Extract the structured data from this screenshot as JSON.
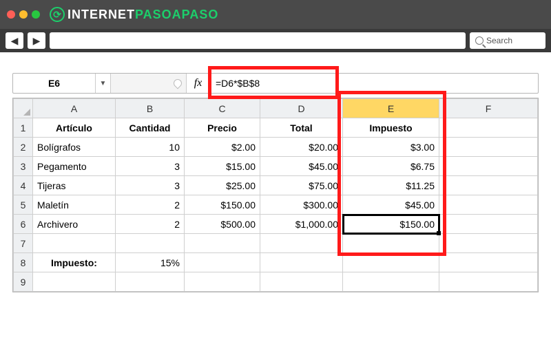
{
  "brand": {
    "white": "INTERNET",
    "green": "PASOAPASO"
  },
  "search": {
    "placeholder": "Search"
  },
  "nav": {
    "back": "◀",
    "fwd": "▶"
  },
  "formula_bar": {
    "name_box": "E6",
    "fx": "fx",
    "formula": "=D6*$B$8"
  },
  "columns": [
    "A",
    "B",
    "C",
    "D",
    "E",
    "F"
  ],
  "rows": [
    "1",
    "2",
    "3",
    "4",
    "5",
    "6",
    "7",
    "8",
    "9"
  ],
  "headers": {
    "A": "Artículo",
    "B": "Cantidad",
    "C": "Precio",
    "D": "Total",
    "E": "Impuesto"
  },
  "data": [
    {
      "art": "Bolígrafos",
      "cant": "10",
      "precio": "$2.00",
      "total": "$20.00",
      "imp": "$3.00"
    },
    {
      "art": "Pegamento",
      "cant": "3",
      "precio": "$15.00",
      "total": "$45.00",
      "imp": "$6.75"
    },
    {
      "art": "Tijeras",
      "cant": "3",
      "precio": "$25.00",
      "total": "$75.00",
      "imp": "$11.25"
    },
    {
      "art": "Maletín",
      "cant": "2",
      "precio": "$150.00",
      "total": "$300.00",
      "imp": "$45.00"
    },
    {
      "art": "Archivero",
      "cant": "2",
      "precio": "$500.00",
      "total": "$1,000.00",
      "imp": "$150.00"
    }
  ],
  "tax_row": {
    "label": "Impuesto:",
    "value": "15%"
  },
  "chart_data": {
    "type": "table",
    "title": "Spreadsheet with tax calculation",
    "columns": [
      "Artículo",
      "Cantidad",
      "Precio",
      "Total",
      "Impuesto"
    ],
    "rows": [
      [
        "Bolígrafos",
        10,
        2.0,
        20.0,
        3.0
      ],
      [
        "Pegamento",
        3,
        15.0,
        45.0,
        6.75
      ],
      [
        "Tijeras",
        3,
        25.0,
        75.0,
        11.25
      ],
      [
        "Maletín",
        2,
        150.0,
        300.0,
        45.0
      ],
      [
        "Archivero",
        2,
        500.0,
        1000.0,
        150.0
      ]
    ],
    "tax_rate": 0.15,
    "active_formula": "=D6*$B$8"
  }
}
